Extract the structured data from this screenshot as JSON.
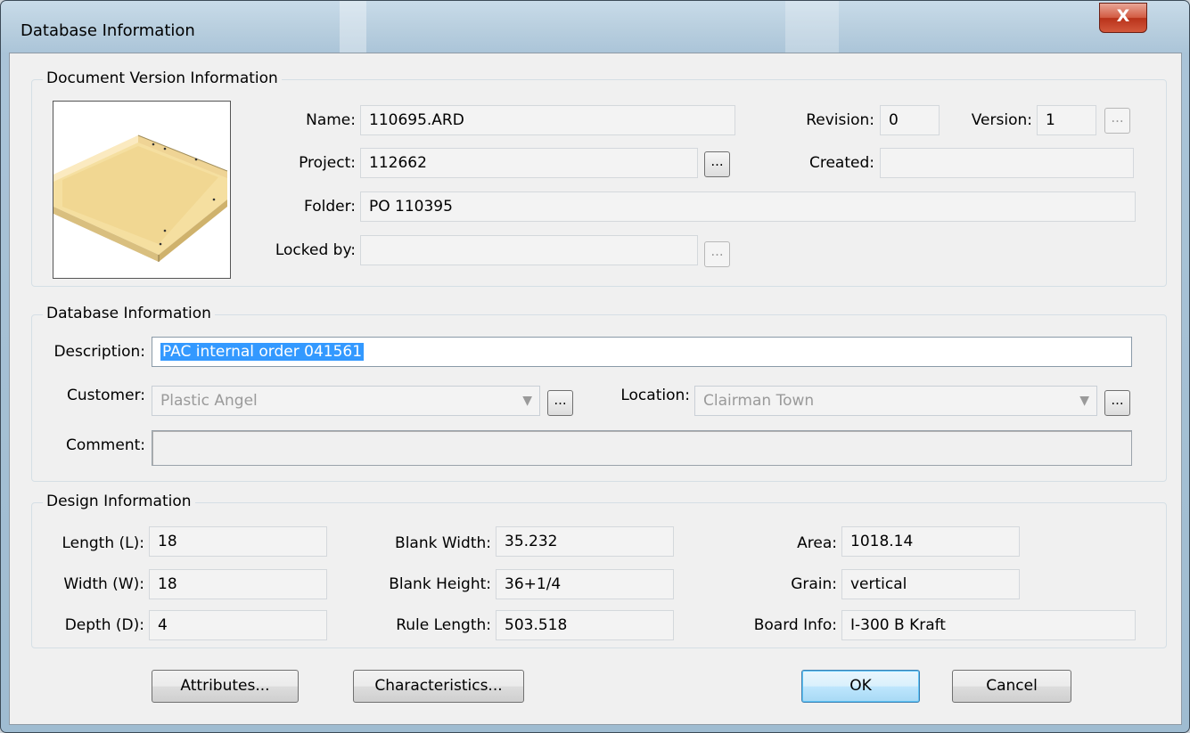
{
  "window": {
    "title": "Database Information",
    "close_label": "X"
  },
  "doc_version": {
    "group_title": "Document Version Information",
    "name_label": "Name:",
    "name_value": "110695.ARD",
    "project_label": "Project:",
    "project_value": "112662",
    "folder_label": "Folder:",
    "folder_value": "PO 110395",
    "locked_label": "Locked by:",
    "locked_value": "",
    "revision_label": "Revision:",
    "revision_value": "0",
    "version_label": "Version:",
    "version_value": "1",
    "created_label": "Created:",
    "created_value": "",
    "dots": "..."
  },
  "db_info": {
    "group_title": "Database Information",
    "description_label": "Description:",
    "description_value": "PAC internal order 041561",
    "customer_label": "Customer:",
    "customer_value": "Plastic Angel",
    "location_label": "Location:",
    "location_value": "Clairman Town",
    "comment_label": "Comment:",
    "comment_value": ""
  },
  "design_info": {
    "group_title": "Design Information",
    "length_label": "Length (L):",
    "length_value": "18",
    "width_label": "Width (W):",
    "width_value": "18",
    "depth_label": "Depth (D):",
    "depth_value": "4",
    "blank_width_label": "Blank Width:",
    "blank_width_value": "35.232",
    "blank_height_label": "Blank Height:",
    "blank_height_value": "36+1/4",
    "rule_length_label": "Rule Length:",
    "rule_length_value": "503.518",
    "area_label": "Area:",
    "area_value": "1018.14",
    "grain_label": "Grain:",
    "grain_value": "vertical",
    "board_label": "Board Info:",
    "board_value": "I-300 B Kraft"
  },
  "buttons": {
    "attributes": "Attributes...",
    "characteristics": "Characteristics...",
    "ok": "OK",
    "cancel": "Cancel"
  },
  "icons": {
    "dropdown": "chevron-down-icon",
    "thumbnail": "box-tray-thumbnail"
  }
}
